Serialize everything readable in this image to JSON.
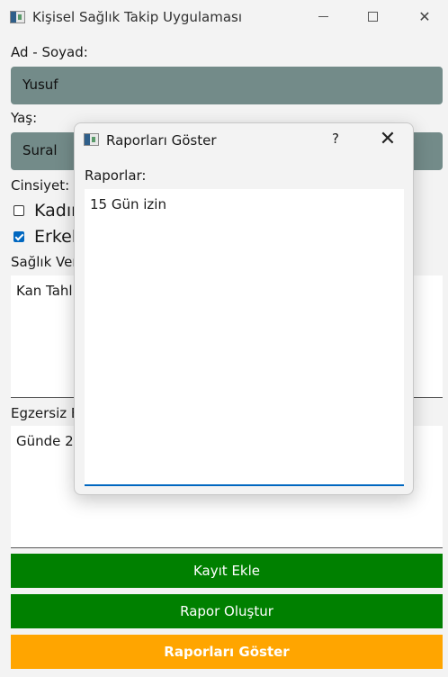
{
  "window": {
    "title": "Kişisel Sağlık Takip Uygulaması",
    "minimize_glyph": "—",
    "close_glyph": "✕"
  },
  "form": {
    "name_label": "Ad - Soyad:",
    "name_value": "Yusuf",
    "age_label": "Yaş:",
    "age_value": "Sural",
    "gender_label": "Cinsiyet:",
    "gender_options": [
      {
        "label": "Kadın",
        "checked": false
      },
      {
        "label": "Erkek",
        "checked": true
      }
    ],
    "health_label": "Sağlık Verileri:",
    "health_value": "Kan Tahlili",
    "exercise_label": "Egzersiz Bilgileri:",
    "exercise_value": "Günde 2"
  },
  "buttons": {
    "add_record": "Kayıt Ekle",
    "create_report": "Rapor Oluştur",
    "show_reports": "Raporları Göster"
  },
  "colors": {
    "field_bg": "#738b89",
    "green": "#008000",
    "orange": "#ffa500",
    "accent": "#0067c0"
  },
  "dialog": {
    "title": "Raporları Göster",
    "help": "?",
    "close": "✕",
    "reports_label": "Raporlar:",
    "reports_text": "15 Gün izin"
  }
}
